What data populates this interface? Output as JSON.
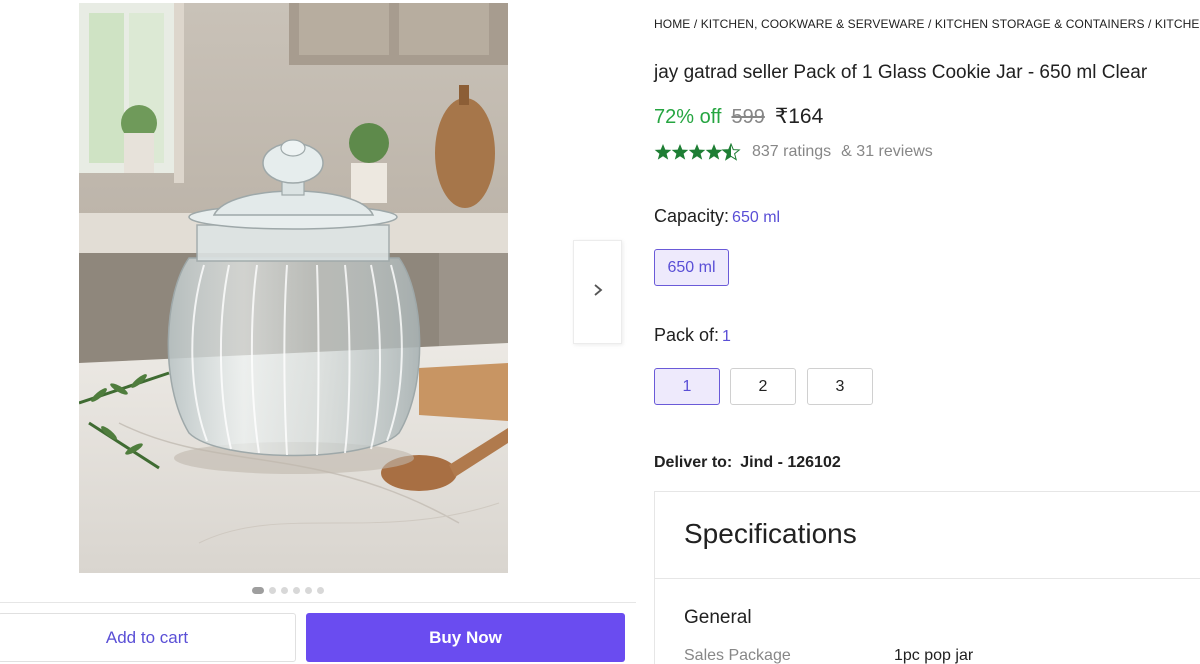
{
  "breadcrumb": "HOME / KITCHEN, COOKWARE & SERVEWARE / KITCHEN STORAGE & CONTAINERS / KITCHEN CONTAINERS",
  "product": {
    "title": "jay gatrad seller Pack of 1 Glass Cookie Jar  - 650 ml Clear",
    "discount": "72% off",
    "mrp": "599",
    "price": "₹164",
    "rating_stars": 4.5,
    "ratings": "837 ratings",
    "reviews": "& 31 reviews"
  },
  "capacity": {
    "label": "Capacity:",
    "selected": "650 ml",
    "options": [
      "650 ml"
    ]
  },
  "pack": {
    "label": "Pack of:",
    "selected": "1",
    "options": [
      "1",
      "2",
      "3"
    ]
  },
  "delivery": {
    "label": "Deliver to:",
    "location": "Jind - 126102"
  },
  "specifications": {
    "title": "Specifications",
    "section": "General",
    "row_key": "Sales Package",
    "row_value": "1pc pop jar"
  },
  "gallery": {
    "image_count": 6,
    "active_index": 0
  },
  "actions": {
    "add_to_cart": "Add to cart",
    "buy_now": "Buy Now"
  },
  "colors": {
    "accent": "#6a4cf0",
    "discount_green": "#26a541",
    "star_green": "#1e7e34"
  },
  "icons": {
    "next": "chevron-right-icon",
    "star": "star-icon"
  }
}
